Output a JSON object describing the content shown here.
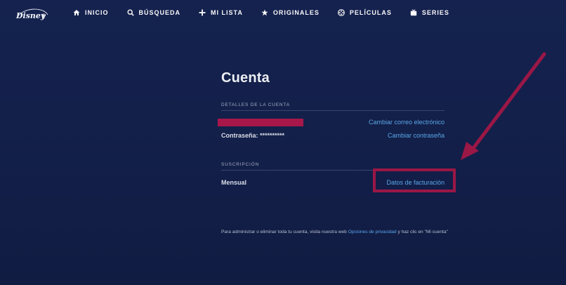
{
  "brand": {
    "logo_text": "Disney+"
  },
  "nav": {
    "items": [
      {
        "label": "INICIO",
        "icon": "home-icon"
      },
      {
        "label": "BÚSQUEDA",
        "icon": "search-icon"
      },
      {
        "label": "MI LISTA",
        "icon": "plus-icon"
      },
      {
        "label": "ORIGINALES",
        "icon": "star-icon"
      },
      {
        "label": "PELÍCULAS",
        "icon": "film-icon"
      },
      {
        "label": "SERIES",
        "icon": "tv-icon"
      }
    ]
  },
  "account": {
    "title": "Cuenta",
    "details_label": "DETALLES DE LA CUENTA",
    "change_email": "Cambiar correo electrónico",
    "password_label": "Contraseña: **********",
    "change_password": "Cambiar contraseña",
    "subscription_label": "SUSCRIPCIÓN",
    "plan": "Mensual",
    "billing_link": "Datos de facturación",
    "footer_before": "Para administrar o eliminar toda tu cuenta, visita nuestra web ",
    "footer_link": "Opciones de privacidad",
    "footer_after": " y haz clic en \"Mi cuenta\""
  },
  "colors": {
    "background": "#13204a",
    "link": "#5aa7e8",
    "annotation": "#9a1746"
  }
}
